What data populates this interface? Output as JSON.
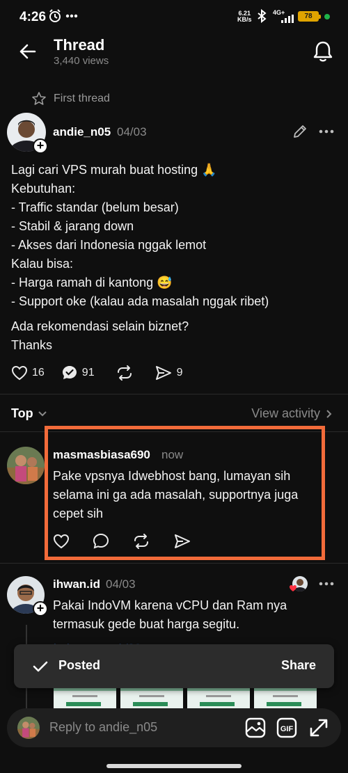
{
  "status_bar": {
    "time": "4:26",
    "net_speed": "6.21",
    "net_unit": "KB/s",
    "network_type": "4G+",
    "battery": "78",
    "colors": {
      "battery": "#e0a400",
      "dot": "#1fb34a"
    }
  },
  "header": {
    "title": "Thread",
    "views": "3,440 views"
  },
  "first_thread_label": "First thread",
  "post": {
    "author": "andie_n05",
    "date": "04/03",
    "body_paragraph_1": "Lagi cari VPS murah buat hosting 🙏\nKebutuhan:\n- Traffic standar (belum besar)\n- Stabil & jarang down\n- Akses dari Indonesia nggak lemot\nKalau bisa:\n- Harga ramah di kantong 😅\n- Support oke (kalau ada masalah nggak ribet)",
    "body_paragraph_2": "Ada rekomendasi selain biznet?\nThanks",
    "likes": "16",
    "replies": "91",
    "shares": "9"
  },
  "sort": {
    "label": "Top",
    "view_activity": "View activity"
  },
  "replies": [
    {
      "author": "masmasbiasa690",
      "time": "now",
      "text": "Pake vpsnya Idwebhost bang, lumayan sih selama ini ga ada masalah, supportnya juga cepet sih"
    },
    {
      "author": "ihwan.id",
      "time": "04/03",
      "text": "Pakai IndoVM karena vCPU dan Ram nya termasuk gede buat harga segitu.",
      "link_partial": "indovm.com/r/32"
    }
  ],
  "toast": {
    "label": "Posted",
    "action": "Share"
  },
  "reply_bar": {
    "placeholder": "Reply to andie_n05"
  },
  "colors": {
    "highlight": "#f26b3a",
    "background": "#0f0f0f"
  }
}
